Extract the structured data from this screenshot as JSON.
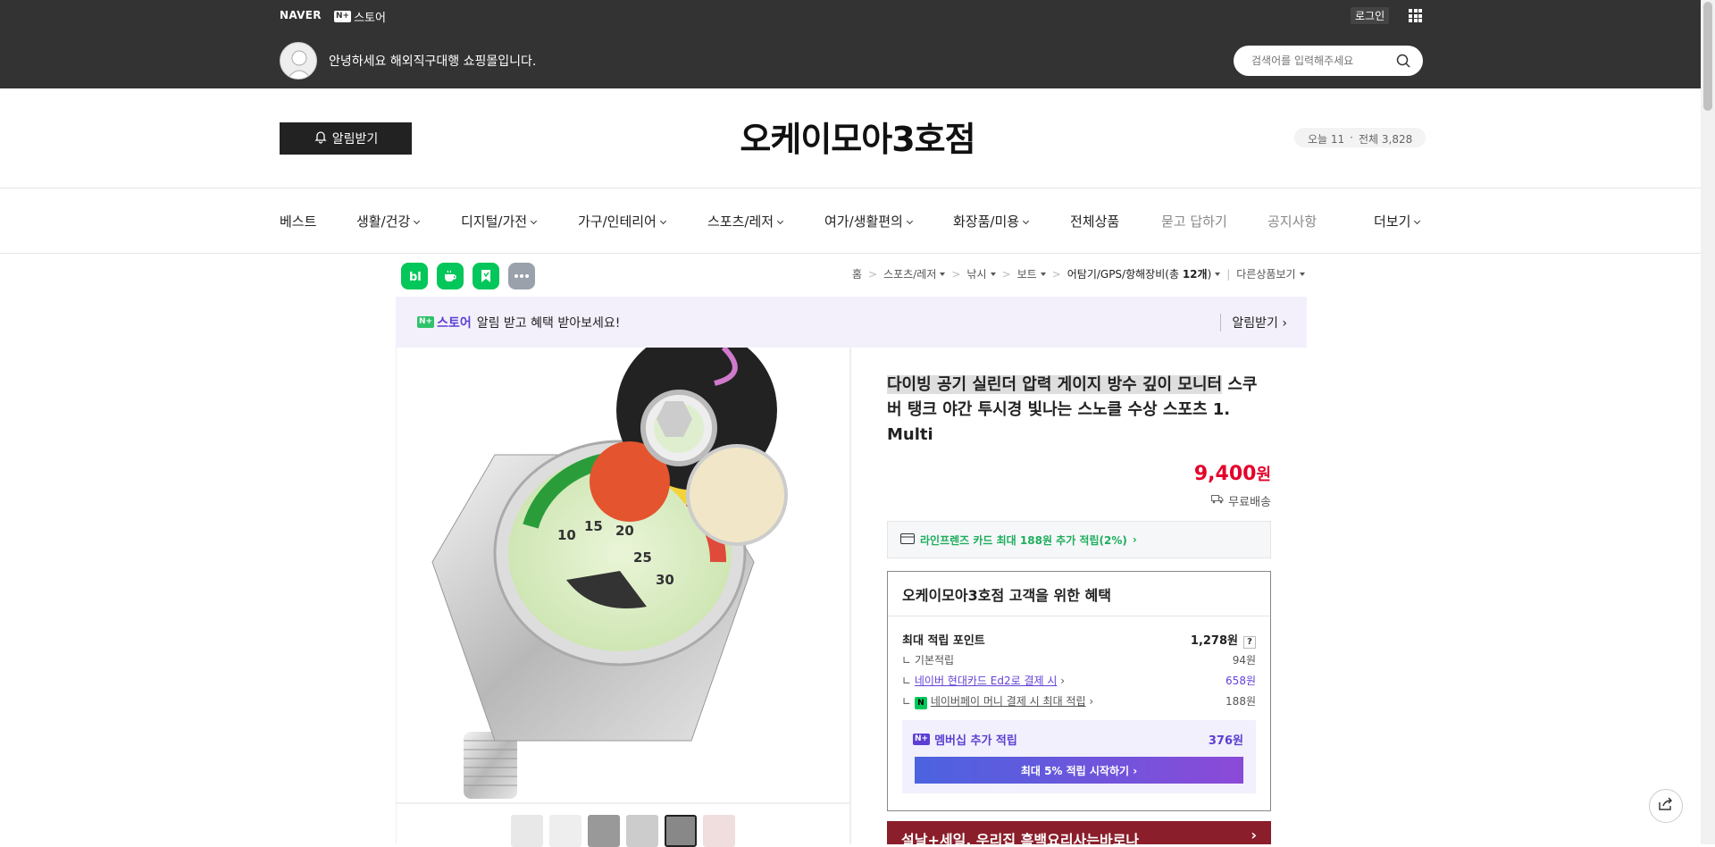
{
  "header": {
    "naver_logo": "NAVER",
    "nstore_badge": "N+",
    "nstore_label": "스토어",
    "login_label": "로그인",
    "greeting": "안녕하세요 해외직구대행 쇼핑몰입니다.",
    "search_placeholder": "검색어를 입력해주세요"
  },
  "store": {
    "notify_label": "알림받기",
    "title": "오케이모아3호점",
    "visits_today": "오늘 11",
    "visits_total": "전체 3,828"
  },
  "nav": [
    {
      "label": "베스트"
    },
    {
      "label": "생활/건강"
    },
    {
      "label": "디지털/가전"
    },
    {
      "label": "가구/인테리어"
    },
    {
      "label": "스포츠/레저"
    },
    {
      "label": "여가/생활편의"
    },
    {
      "label": "화장품/미용"
    },
    {
      "label": "전체상품"
    },
    {
      "label": "묻고 답하기"
    },
    {
      "label": "공지사항"
    },
    {
      "label": "더보기"
    }
  ],
  "breadcrumb": {
    "home": "홈",
    "c1": "스포츠/레저",
    "c2": "낚시",
    "c3": "보트",
    "c4": "어탐기/GPS/항해장비",
    "c4_count_prefix": "(총 ",
    "c4_count": "12개",
    "c4_count_suffix": ")",
    "other": "다른상품보기"
  },
  "promo": {
    "badge": "N+",
    "store": "스토어",
    "message": "알림 받고 혜택 받아보세요!",
    "action": "알림받기"
  },
  "product": {
    "title_highlight": "다이빙 공기 실린더 압력 게이지 방수 깊이 모니터",
    "title_rest": " 스쿠버 탱크 야간 투시경 빛나는 스노클 수상 스포츠 1. Multi",
    "price": "9,400",
    "price_unit": "원",
    "shipping": "무료배송",
    "card_benefit": "라인프렌즈 카드 최대 188원 추가 적립(2%)"
  },
  "benefit": {
    "header": "오케이모아3호점 고객을 위한 혜택",
    "max_points_label": "최대 적립 포인트",
    "max_points": "1,278원",
    "help": "?",
    "basic_label": "기본적립",
    "basic": "94원",
    "hyundai_label": "네이버 현대카드 Ed2로 결제 시",
    "hyundai": "658원",
    "npay_icon": "N",
    "npay_label": "네이버페이 머니 결제 시 최대 적립",
    "npay": "188원",
    "member_badge": "N+",
    "member_label": "멤버십 추가 적립",
    "member": "376원",
    "member_cta": "최대 5% 적립 시작하기"
  },
  "banner": {
    "text": "설날+세일, 우리집 흑백요리사는바로나"
  },
  "colors": {
    "topbar": "#333333",
    "price": "#e4002b",
    "purple": "#5d3fd3",
    "green": "#1dae5c"
  }
}
